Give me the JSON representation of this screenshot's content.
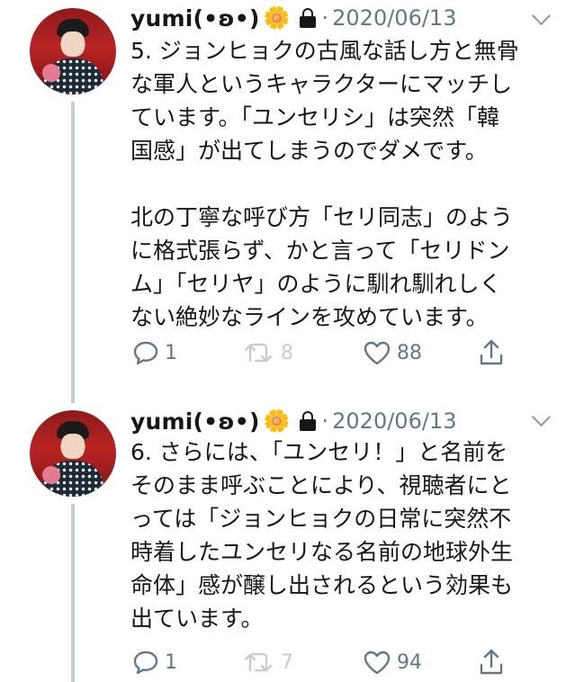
{
  "tweets": [
    {
      "author": "yumi(•ʚ•)",
      "emoji": "🌼",
      "date": "2020/06/13",
      "dot": "·",
      "text": "5. ジョンヒョクの古風な話し方と無骨\nな軍人というキャラクターにマッチし\nています。「ユンセリシ」は突然「韓\n国感」が出てしまうのでダメです。\n\n北の丁寧な呼び方「セリ同志」のよう\nに格式張らず、かと言って「セリドン\nム」「セリヤ」のように馴れ馴れしく\nない絶妙なラインを攻めています。",
      "reply_count": "1",
      "retweet_count": "8",
      "like_count": "88"
    },
    {
      "author": "yumi(•ʚ•)",
      "emoji": "🌼",
      "date": "2020/06/13",
      "dot": "·",
      "text": "6. さらには、「ユンセリ！」と名前を\nそのまま呼ぶことにより、視聴者にと\nっては「ジョンヒョクの日常に突然不\n時着したユンセリなる名前の地球外生\n命体」感が醸し出されるという効果も\n出ています。",
      "reply_count": "1",
      "retweet_count": "7",
      "like_count": "94"
    }
  ],
  "icons": {
    "reply": "reply-icon",
    "retweet": "retweet-icon",
    "like": "heart-icon",
    "share": "share-icon",
    "lock": "lock-icon",
    "caret": "chevron-down-icon"
  },
  "colors": {
    "secondary_text": "#657786",
    "thread_line": "#c4cfd6",
    "disabled_icon": "#c6ced4"
  }
}
